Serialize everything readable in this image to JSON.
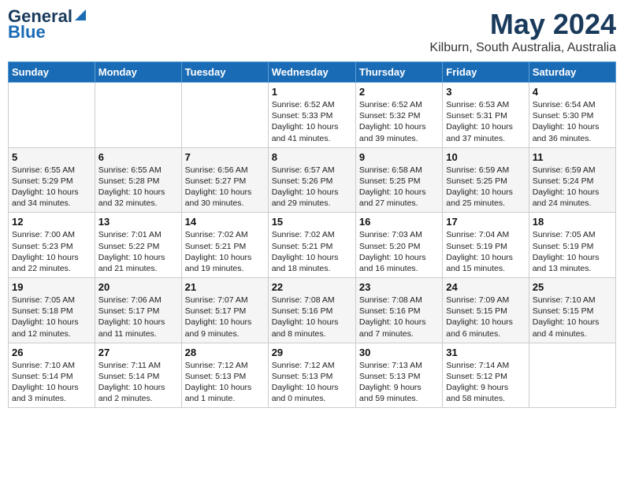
{
  "header": {
    "logo_line1": "General",
    "logo_line2": "Blue",
    "month_year": "May 2024",
    "location": "Kilburn, South Australia, Australia"
  },
  "days_of_week": [
    "Sunday",
    "Monday",
    "Tuesday",
    "Wednesday",
    "Thursday",
    "Friday",
    "Saturday"
  ],
  "weeks": [
    [
      {
        "num": "",
        "info": ""
      },
      {
        "num": "",
        "info": ""
      },
      {
        "num": "",
        "info": ""
      },
      {
        "num": "1",
        "info": "Sunrise: 6:52 AM\nSunset: 5:33 PM\nDaylight: 10 hours\nand 41 minutes."
      },
      {
        "num": "2",
        "info": "Sunrise: 6:52 AM\nSunset: 5:32 PM\nDaylight: 10 hours\nand 39 minutes."
      },
      {
        "num": "3",
        "info": "Sunrise: 6:53 AM\nSunset: 5:31 PM\nDaylight: 10 hours\nand 37 minutes."
      },
      {
        "num": "4",
        "info": "Sunrise: 6:54 AM\nSunset: 5:30 PM\nDaylight: 10 hours\nand 36 minutes."
      }
    ],
    [
      {
        "num": "5",
        "info": "Sunrise: 6:55 AM\nSunset: 5:29 PM\nDaylight: 10 hours\nand 34 minutes."
      },
      {
        "num": "6",
        "info": "Sunrise: 6:55 AM\nSunset: 5:28 PM\nDaylight: 10 hours\nand 32 minutes."
      },
      {
        "num": "7",
        "info": "Sunrise: 6:56 AM\nSunset: 5:27 PM\nDaylight: 10 hours\nand 30 minutes."
      },
      {
        "num": "8",
        "info": "Sunrise: 6:57 AM\nSunset: 5:26 PM\nDaylight: 10 hours\nand 29 minutes."
      },
      {
        "num": "9",
        "info": "Sunrise: 6:58 AM\nSunset: 5:25 PM\nDaylight: 10 hours\nand 27 minutes."
      },
      {
        "num": "10",
        "info": "Sunrise: 6:59 AM\nSunset: 5:25 PM\nDaylight: 10 hours\nand 25 minutes."
      },
      {
        "num": "11",
        "info": "Sunrise: 6:59 AM\nSunset: 5:24 PM\nDaylight: 10 hours\nand 24 minutes."
      }
    ],
    [
      {
        "num": "12",
        "info": "Sunrise: 7:00 AM\nSunset: 5:23 PM\nDaylight: 10 hours\nand 22 minutes."
      },
      {
        "num": "13",
        "info": "Sunrise: 7:01 AM\nSunset: 5:22 PM\nDaylight: 10 hours\nand 21 minutes."
      },
      {
        "num": "14",
        "info": "Sunrise: 7:02 AM\nSunset: 5:21 PM\nDaylight: 10 hours\nand 19 minutes."
      },
      {
        "num": "15",
        "info": "Sunrise: 7:02 AM\nSunset: 5:21 PM\nDaylight: 10 hours\nand 18 minutes."
      },
      {
        "num": "16",
        "info": "Sunrise: 7:03 AM\nSunset: 5:20 PM\nDaylight: 10 hours\nand 16 minutes."
      },
      {
        "num": "17",
        "info": "Sunrise: 7:04 AM\nSunset: 5:19 PM\nDaylight: 10 hours\nand 15 minutes."
      },
      {
        "num": "18",
        "info": "Sunrise: 7:05 AM\nSunset: 5:19 PM\nDaylight: 10 hours\nand 13 minutes."
      }
    ],
    [
      {
        "num": "19",
        "info": "Sunrise: 7:05 AM\nSunset: 5:18 PM\nDaylight: 10 hours\nand 12 minutes."
      },
      {
        "num": "20",
        "info": "Sunrise: 7:06 AM\nSunset: 5:17 PM\nDaylight: 10 hours\nand 11 minutes."
      },
      {
        "num": "21",
        "info": "Sunrise: 7:07 AM\nSunset: 5:17 PM\nDaylight: 10 hours\nand 9 minutes."
      },
      {
        "num": "22",
        "info": "Sunrise: 7:08 AM\nSunset: 5:16 PM\nDaylight: 10 hours\nand 8 minutes."
      },
      {
        "num": "23",
        "info": "Sunrise: 7:08 AM\nSunset: 5:16 PM\nDaylight: 10 hours\nand 7 minutes."
      },
      {
        "num": "24",
        "info": "Sunrise: 7:09 AM\nSunset: 5:15 PM\nDaylight: 10 hours\nand 6 minutes."
      },
      {
        "num": "25",
        "info": "Sunrise: 7:10 AM\nSunset: 5:15 PM\nDaylight: 10 hours\nand 4 minutes."
      }
    ],
    [
      {
        "num": "26",
        "info": "Sunrise: 7:10 AM\nSunset: 5:14 PM\nDaylight: 10 hours\nand 3 minutes."
      },
      {
        "num": "27",
        "info": "Sunrise: 7:11 AM\nSunset: 5:14 PM\nDaylight: 10 hours\nand 2 minutes."
      },
      {
        "num": "28",
        "info": "Sunrise: 7:12 AM\nSunset: 5:13 PM\nDaylight: 10 hours\nand 1 minute."
      },
      {
        "num": "29",
        "info": "Sunrise: 7:12 AM\nSunset: 5:13 PM\nDaylight: 10 hours\nand 0 minutes."
      },
      {
        "num": "30",
        "info": "Sunrise: 7:13 AM\nSunset: 5:13 PM\nDaylight: 9 hours\nand 59 minutes."
      },
      {
        "num": "31",
        "info": "Sunrise: 7:14 AM\nSunset: 5:12 PM\nDaylight: 9 hours\nand 58 minutes."
      },
      {
        "num": "",
        "info": ""
      }
    ]
  ]
}
